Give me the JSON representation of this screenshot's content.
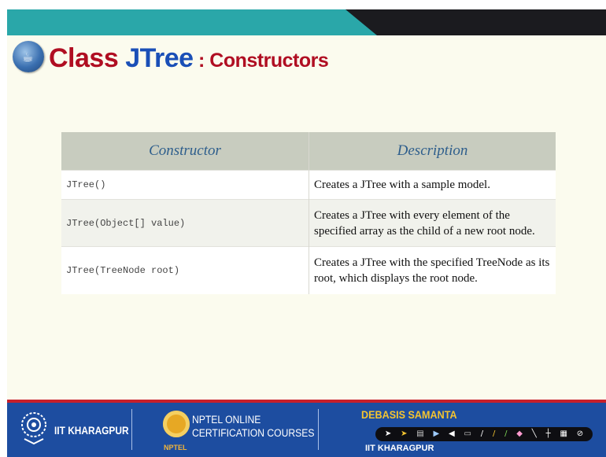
{
  "slide": {
    "title": {
      "part1": "Class ",
      "part2": "JTree",
      "part3": " : Constructors"
    },
    "logo_icon": "java-cup-icon"
  },
  "table": {
    "headers": [
      "Constructor",
      "Description"
    ],
    "rows": [
      {
        "constructor": "JTree()",
        "description": "Creates a JTree with a sample model."
      },
      {
        "constructor": "JTree(Object[] value)",
        "description": "Creates a JTree with every element of the specified array as the child of a new root node."
      },
      {
        "constructor": "JTree(TreeNode root)",
        "description": "Creates a JTree with the specified TreeNode as its root, which displays the root node."
      }
    ]
  },
  "footer": {
    "institute": "IIT KHARAGPUR",
    "nptel_line1": "NPTEL ONLINE",
    "nptel_line2": "CERTIFICATION COURSES",
    "nptel_small": "NPTEL",
    "presenter": "DEBASIS SAMANTA",
    "presenter_institute": "IIT KHARAGPUR"
  },
  "colors": {
    "title_red": "#b00e22",
    "title_blue": "#1a4fb7",
    "header_band": "#2aa7a9",
    "footer_blue": "#1d4da0",
    "table_header_bg": "#c8ccbf",
    "table_header_text": "#2e5e8c"
  }
}
